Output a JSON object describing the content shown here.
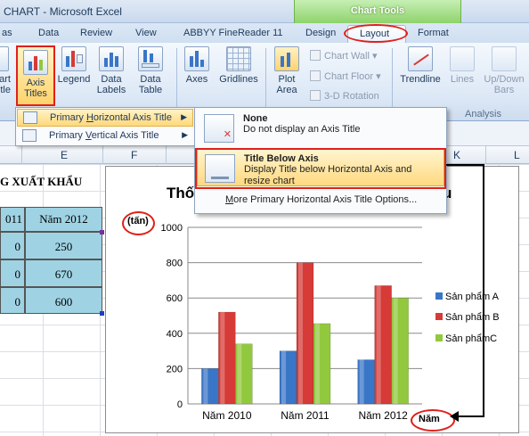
{
  "window": {
    "title": "CHART - Microsoft Excel",
    "context_group": "Chart Tools"
  },
  "tabs": [
    {
      "label": "as"
    },
    {
      "label": "Data"
    },
    {
      "label": "Review"
    },
    {
      "label": "View"
    },
    {
      "label": "ABBYY FineReader 11"
    },
    {
      "label": "Design"
    },
    {
      "label": "Layout"
    },
    {
      "label": "Format"
    }
  ],
  "ribbon": {
    "chart_title_partial": {
      "l1": "art",
      "l2": "tle"
    },
    "axis_titles": {
      "l1": "Axis",
      "l2": "Titles"
    },
    "legend": {
      "l1": "Legend"
    },
    "data_labels": {
      "l1": "Data",
      "l2": "Labels"
    },
    "data_table": {
      "l1": "Data",
      "l2": "Table"
    },
    "axes": {
      "l1": "Axes"
    },
    "gridlines": {
      "l1": "Gridlines"
    },
    "plot_area": {
      "l1": "Plot",
      "l2": "Area"
    },
    "chart_wall": "Chart Wall",
    "chart_floor": "Chart Floor",
    "rotation_3d": "3-D Rotation",
    "trendline": {
      "l1": "Trendline"
    },
    "lines": {
      "l1": "Lines"
    },
    "updown_bars": {
      "l1": "Up/Down",
      "l2": "Bars"
    },
    "analysis_label": "Analysis"
  },
  "menu": {
    "item1": {
      "pre": "Primary ",
      "key": "H",
      "post": "orizontal Axis Title"
    },
    "item2": {
      "pre": "Primary ",
      "key": "V",
      "post": "ertical Axis Title"
    }
  },
  "flyout": {
    "none_heading": "None",
    "none_desc": "Do not display an Axis Title",
    "below_heading": "Title Below Axis",
    "below_desc_1": "Display Title below Horizontal Axis and",
    "below_desc_2": "resize chart",
    "more_key": "M",
    "more_rest": "ore Primary Horizontal Axis Title Options..."
  },
  "columns": {
    "e": "E",
    "f": "F",
    "k": "K",
    "l": "L"
  },
  "sheet": {
    "title_partial": "G XUẤT KHẨU",
    "header_partial": "011",
    "header_2012": "Năm 2012",
    "rows": [
      {
        "prev": "0",
        "val": "250"
      },
      {
        "prev": "0",
        "val": "670"
      },
      {
        "prev": "0",
        "val": "600"
      }
    ]
  },
  "chart": {
    "title_left": "Thố",
    "title_right": "u",
    "y_axis_title": "(tấn)",
    "x_axis_title": "Năm",
    "colors": {
      "series_a": "#3a76c7",
      "series_b": "#d63b37",
      "series_c": "#92c83e"
    }
  },
  "chart_data": {
    "type": "bar",
    "categories": [
      "Năm 2010",
      "Năm 2011",
      "Năm 2012"
    ],
    "series": [
      {
        "name": "Sản phẩm A",
        "values": [
          200,
          300,
          250
        ]
      },
      {
        "name": "Sản phẩm B",
        "values": [
          520,
          800,
          670
        ]
      },
      {
        "name": "Sản phẩmC",
        "values": [
          340,
          455,
          600
        ]
      }
    ],
    "yticks": [
      "0",
      "200",
      "400",
      "600",
      "800",
      "1000"
    ],
    "ylim": [
      0,
      1000
    ],
    "ylabel": "(tấn)",
    "xlabel": "Năm",
    "grid": true,
    "legend": "right"
  }
}
